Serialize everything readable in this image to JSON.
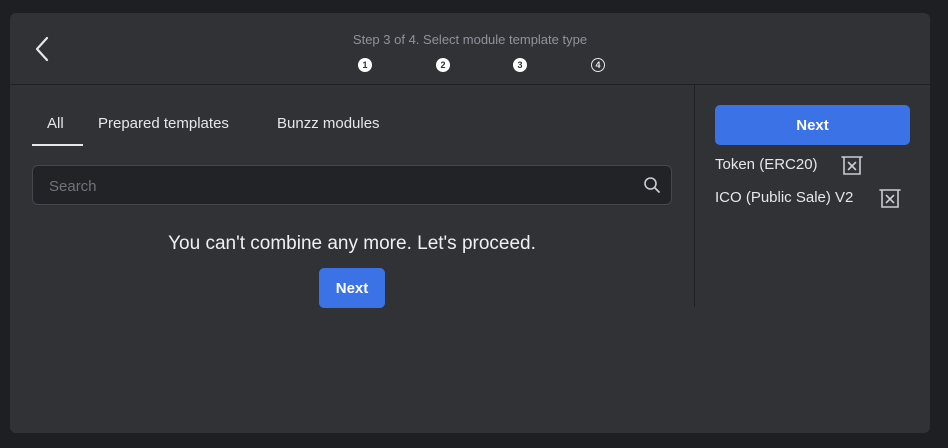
{
  "header": {
    "step_text": "Step 3 of 4. Select module template type",
    "steps": [
      "1",
      "2",
      "3",
      "4"
    ],
    "back_icon": "chevron-left-icon"
  },
  "tabs": [
    {
      "label": "All",
      "active": true
    },
    {
      "label": "Prepared templates",
      "active": false
    },
    {
      "label": "Bunzz modules",
      "active": false
    }
  ],
  "search": {
    "placeholder": "Search",
    "value": "",
    "icon": "search-icon"
  },
  "main": {
    "message": "You can't combine any more. Let's proceed.",
    "next_label": "Next"
  },
  "sidebar": {
    "next_label": "Next",
    "selected": [
      {
        "label": "Token (ERC20)",
        "icon": "trash-icon"
      },
      {
        "label": "ICO (Public Sale) V2",
        "icon": "trash-icon"
      }
    ]
  },
  "colors": {
    "accent": "#3b72e6",
    "panel": "#303236",
    "background": "#1e1f22"
  }
}
